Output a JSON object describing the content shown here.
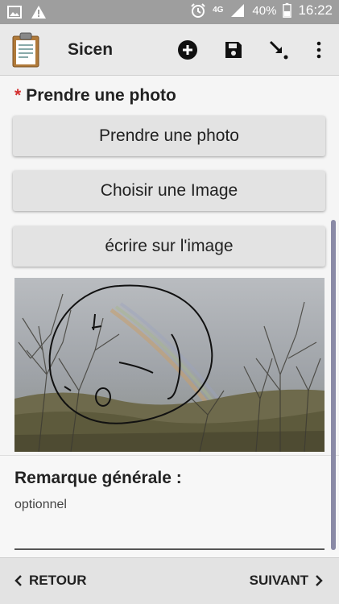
{
  "status_bar": {
    "network": "4G",
    "battery": "40%",
    "time": "16:22",
    "icons": [
      "image-notification-icon",
      "warning-icon",
      "alarm-icon",
      "signal-icon",
      "battery-icon"
    ]
  },
  "toolbar": {
    "title": "Sicen",
    "icons": [
      "clipboard-icon",
      "add-circle-icon",
      "save-icon",
      "finalize-icon",
      "more-vertical-icon"
    ]
  },
  "question": {
    "required_mark": "*",
    "title": "Prendre une photo",
    "buttons": {
      "take_photo": "Prendre une photo",
      "choose_image": "Choisir une Image",
      "draw_on_image": "écrire sur l'image"
    }
  },
  "remark": {
    "title": "Remarque générale :",
    "hint": "optionnel",
    "value": ""
  },
  "bottom_nav": {
    "back": "RETOUR",
    "next": "SUIVANT"
  },
  "colors": {
    "status_bar": "#9e9e9e",
    "toolbar": "#e9e9e9",
    "required": "#d32f2f",
    "scrollbar": "#8a8aa6"
  }
}
